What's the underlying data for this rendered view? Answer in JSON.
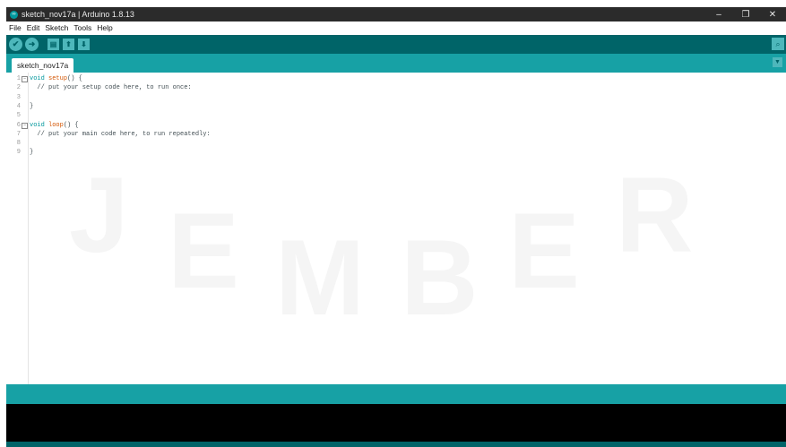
{
  "window": {
    "title": "sketch_nov17a | Arduino 1.8.13",
    "minimize": "–",
    "restore": "❐",
    "close": "✕"
  },
  "menu": [
    "File",
    "Edit",
    "Sketch",
    "Tools",
    "Help"
  ],
  "toolbar": {
    "verify_icon": "check-icon",
    "upload_icon": "arrow-right-icon",
    "new_icon": "new-file-icon",
    "open_icon": "open-arrow-up-icon",
    "save_icon": "save-arrow-down-icon",
    "serial_monitor_icon": "magnifier-icon"
  },
  "tabs": [
    {
      "label": "sketch_nov17a"
    }
  ],
  "editor": {
    "lines": [
      {
        "num": "1",
        "fold": true,
        "parts": [
          [
            "kw",
            "void"
          ],
          [
            "",
            " "
          ],
          [
            "fn",
            "setup"
          ],
          [
            "",
            "() {"
          ]
        ]
      },
      {
        "num": "2",
        "fold": false,
        "parts": [
          [
            "cm",
            "  // put your setup code here, to run once:"
          ]
        ]
      },
      {
        "num": "3",
        "fold": false,
        "parts": []
      },
      {
        "num": "4",
        "fold": false,
        "parts": [
          [
            "",
            "}"
          ]
        ]
      },
      {
        "num": "5",
        "fold": false,
        "parts": []
      },
      {
        "num": "6",
        "fold": true,
        "parts": [
          [
            "kw",
            "void"
          ],
          [
            "",
            " "
          ],
          [
            "fn",
            "loop"
          ],
          [
            "",
            "() {"
          ]
        ]
      },
      {
        "num": "7",
        "fold": false,
        "parts": [
          [
            "cm",
            "  // put your main code here, to run repeatedly:"
          ]
        ]
      },
      {
        "num": "8",
        "fold": false,
        "parts": []
      },
      {
        "num": "9",
        "fold": false,
        "parts": [
          [
            "",
            "}"
          ]
        ]
      }
    ]
  },
  "watermark": {
    "letters": [
      "J",
      "E",
      "M",
      "B",
      "E",
      "R"
    ]
  },
  "colors": {
    "teal_dark": "#006468",
    "teal": "#17a1a5",
    "teal_light": "#4db7bb"
  }
}
